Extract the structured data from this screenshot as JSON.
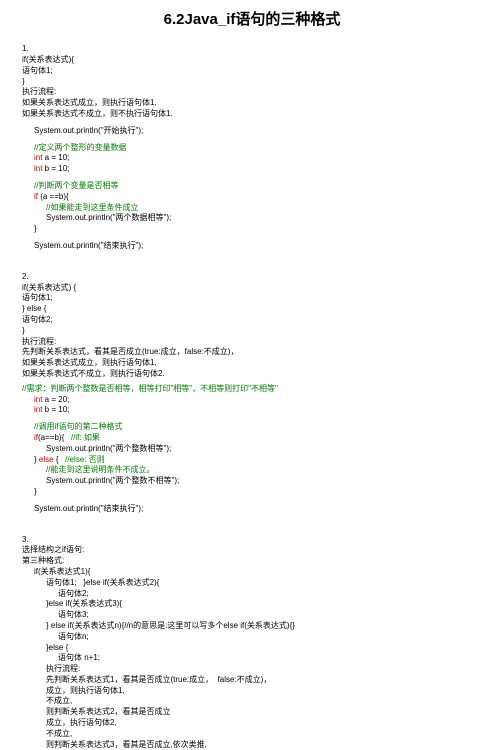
{
  "title": "6.2Java_if语句的三种格式",
  "section1": {
    "num": "1.",
    "l1": "if(关系表达式){",
    "l2": "语句体1;",
    "l3": "}",
    "l4": "执行流程:",
    "l5": "如果关系表达式成立，则执行语句体1,",
    "l6": "如果关系表达式不成立，则不执行语句体1.",
    "c1": "System.out.println(\"开始执行\");",
    "c2": "//定义两个整形的变量数据",
    "c3a": "int",
    "c3b": " a = 10;",
    "c4a": "int",
    "c4b": " b = 10;",
    "c5": "//判断两个变量是否相等",
    "c6a": "if",
    "c6b": " (a ==b){",
    "c7": "//如果能走到这里条件成立",
    "c8": "System.out.println(\"两个数据相等\");",
    "c9": "}",
    "c10": "System.out.println(\"结束执行\");"
  },
  "section2": {
    "num": "2.",
    "l1": "if(关系表达式) {",
    "l2": "语句体1;",
    "l3": "} else {",
    "l4": "语句体2;",
    "l5": "}",
    "l6": "执行流程:",
    "l7": "先判断关系表达式，看其是否成立(true:成立，false:不成立)，",
    "l8": "如果关系表达式成立，则执行语句体1,",
    "l9": "如果关系表达式不成立，则执行语句体2.",
    "c1": "//需求：判断两个整数是否相等，相等打印\"相等\"，不相等则打印\"不相等\"",
    "c2a": "int",
    "c2b": " a = 20;",
    "c3a": "int",
    "c3b": " b = 10;",
    "c4": "//调用if语句的第二种格式",
    "c5a": "if",
    "c5b": "(a==b){   ",
    "c5c": "//if: 如果",
    "c6": "System.out.println(\"两个整数相等\");",
    "c7a": "} ",
    "c7b": "else",
    "c7c": " {   ",
    "c7d": "//else: 否则",
    "c8": "//能走到这里说明条件不成立。",
    "c9": "System.out.println(\"两个整数不相等\");",
    "c10": "}",
    "c11": "System.out.println(\"结束执行\");"
  },
  "section3": {
    "num": "3.",
    "l1": "选择结构之if语句:",
    "l2": "第三种格式:",
    "l3": "if(关系表达式1){",
    "l4": "语句体1;   }else if(关系表达式2){",
    "l5": "语句体2;",
    "l6": "}else if(关系表达式3){",
    "l7": "语句体3;",
    "l8": "} else if(关系表达式n){//n的意思是:这里可以写多个else if(关系表达式){}",
    "l9": "语句体n;",
    "l10": "}else {",
    "l11": "语句体 n+1;",
    "l12": "执行流程:",
    "l13": "先判断关系表达式1，看其是否成立(true:成立，  false:不成立)，",
    "l14": "成立，则执行语句体1,",
    "l15": "不成立,",
    "l16": "则判断关系表达式2，看其是否成立",
    "l17": "成立，执行语句体2,",
    "l18": "不成立,",
    "l19": "则判断关系表达式3，看其是否成立,依次类推,"
  }
}
